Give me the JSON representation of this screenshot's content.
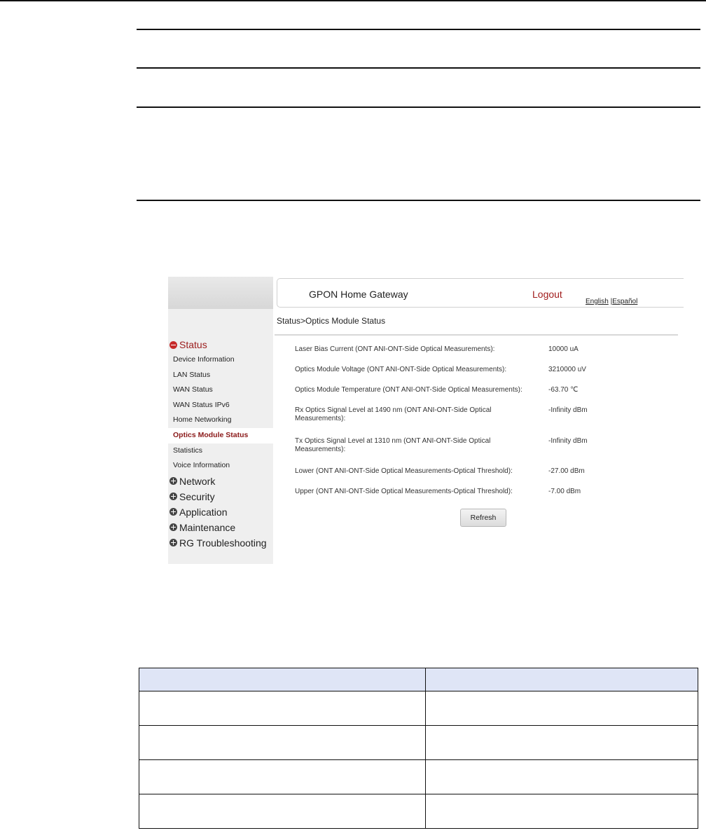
{
  "gateway": {
    "title": "GPON Home Gateway",
    "logout": "Logout",
    "lang_en": "English",
    "lang_sep": "|",
    "lang_es": "Español",
    "breadcrumb": "Status>Optics Module Status"
  },
  "sidebar": {
    "groups": [
      {
        "label": "Status",
        "open": true
      },
      {
        "label": "Network"
      },
      {
        "label": "Security"
      },
      {
        "label": "Application"
      },
      {
        "label": "Maintenance"
      },
      {
        "label": "RG Troubleshooting"
      }
    ],
    "status_items": [
      "Device Information",
      "LAN Status",
      "WAN Status",
      "WAN Status IPv6",
      "Home Networking",
      "Optics Module Status",
      "Statistics",
      "Voice Information"
    ],
    "active_item": "Optics Module Status"
  },
  "measurements": [
    {
      "label": "Laser Bias Current (ONT ANI-ONT-Side Optical Measurements):",
      "value": "10000 uA"
    },
    {
      "label": "Optics Module Voltage (ONT ANI-ONT-Side Optical Measurements):",
      "value": "3210000 uV"
    },
    {
      "label": "Optics Module Temperature (ONT ANI-ONT-Side Optical Measurements):",
      "value": "-63.70 ℃"
    },
    {
      "label": "Rx Optics Signal Level at 1490 nm (ONT ANI-ONT-Side Optical Measurements):",
      "value": "-Infinity dBm"
    },
    {
      "label": "Tx Optics Signal Level at 1310 nm (ONT ANI-ONT-Side Optical Measurements):",
      "value": "-Infinity dBm"
    },
    {
      "label": "Lower (ONT ANI-ONT-Side Optical Measurements-Optical Threshold):",
      "value": "-27.00 dBm"
    },
    {
      "label": "Upper (ONT ANI-ONT-Side Optical Measurements-Optical Threshold):",
      "value": "-7.00 dBm"
    }
  ],
  "refresh_label": "Refresh"
}
